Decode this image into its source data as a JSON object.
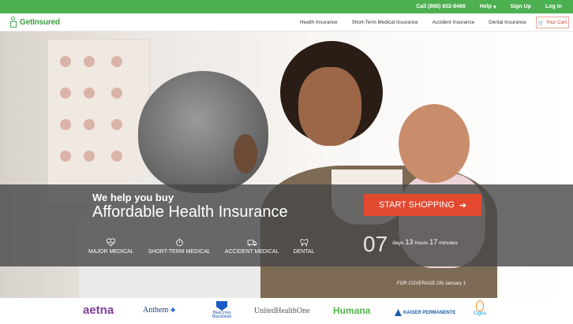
{
  "topbar": {
    "phone": "Call (866) 602-8466",
    "help": "Help",
    "signup": "Sign Up",
    "login": "Log In"
  },
  "brand": {
    "name": "GetInsured"
  },
  "nav": {
    "items": [
      "Health Insurance",
      "Short-Term Medical Insurance",
      "Accident Insurance",
      "Dental Insurance"
    ],
    "cart": "Your Cart"
  },
  "hero": {
    "tagline_small": "We help you buy",
    "tagline_large": "Affordable Health Insurance",
    "cta": "START SHOPPING"
  },
  "products": [
    {
      "label": "MAJOR MEDICAL",
      "icon": "heart-icon"
    },
    {
      "label": "SHORT-TERM MEDICAL",
      "icon": "stopwatch-icon"
    },
    {
      "label": "ACCIDENT MEDICAL",
      "icon": "ambulance-icon"
    },
    {
      "label": "DENTAL",
      "icon": "tooth-icon"
    }
  ],
  "countdown": {
    "days_value": "07",
    "days_label": "days",
    "hours_value": "13",
    "hours_label": "hours",
    "minutes_value": "17",
    "minutes_label": "minutes",
    "caption": "FOR COVERAGE ON January 1"
  },
  "carriers": {
    "aetna": "aetna",
    "anthem": "Anthem",
    "bcbs_line1": "BlueCross",
    "bcbs_line2": "BlueShield",
    "uhc": "UnitedHealthOne",
    "humana": "Humana",
    "kaiser": "KAISER PERMANENTE",
    "cigna": "Cigna"
  },
  "colors": {
    "brand_green": "#4caf50",
    "cta_red": "#e2492f",
    "overlay": "#464646"
  }
}
